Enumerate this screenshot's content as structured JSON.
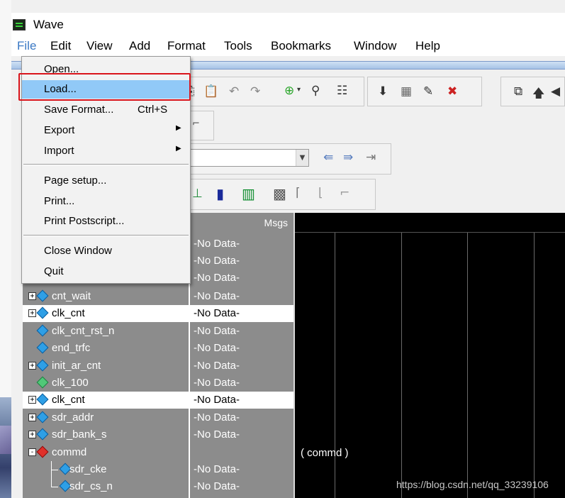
{
  "window": {
    "title": "Wave"
  },
  "menubar": [
    {
      "label": "File",
      "active": true
    },
    {
      "label": "Edit"
    },
    {
      "label": "View"
    },
    {
      "label": "Add"
    },
    {
      "label": "Format"
    },
    {
      "label": "Tools"
    },
    {
      "label": "Bookmarks"
    },
    {
      "label": "Window"
    },
    {
      "label": "Help"
    }
  ],
  "file_menu": {
    "open": "Open...",
    "load": "Load...",
    "save_format": "Save Format...",
    "save_format_shortcut": "Ctrl+S",
    "export": "Export",
    "import": "Import",
    "page_setup": "Page setup...",
    "print": "Print...",
    "print_postscript": "Print Postscript...",
    "close_window": "Close Window",
    "quit": "Quit",
    "highlighted": "Load..."
  },
  "values_header": "Msgs",
  "signals": [
    {
      "name": "",
      "value": "-No Data-"
    },
    {
      "name": "",
      "value": "-No Data-"
    },
    {
      "name": "",
      "value": "-No Data-"
    },
    {
      "name": "cnt_wait",
      "value": "-No Data-",
      "expander": "+",
      "icon": "blue-diamond-icon"
    },
    {
      "name": "clk_cnt",
      "value": "-No Data-",
      "expander": "+",
      "icon": "blue-diamond-icon",
      "selected": true
    },
    {
      "name": "clk_cnt_rst_n",
      "value": "-No Data-",
      "icon": "blue-diamond-icon"
    },
    {
      "name": "end_trfc",
      "value": "-No Data-",
      "icon": "blue-diamond-icon"
    },
    {
      "name": "init_ar_cnt",
      "value": "-No Data-",
      "expander": "+",
      "icon": "blue-diamond-icon"
    },
    {
      "name": "clk_100",
      "value": "-No Data-",
      "icon": "green-diamond-icon"
    },
    {
      "name": "clk_cnt",
      "value": "-No Data-",
      "expander": "+",
      "icon": "blue-diamond-icon",
      "selected": true
    },
    {
      "name": "sdr_addr",
      "value": "-No Data-",
      "expander": "+",
      "icon": "blue-diamond-icon"
    },
    {
      "name": "sdr_bank_s",
      "value": "-No Data-",
      "expander": "+",
      "icon": "blue-diamond-icon"
    },
    {
      "name": "commd",
      "value": "",
      "expander": "-",
      "icon": "red-diamond-icon"
    },
    {
      "name": "sdr_cke",
      "value": "-No Data-",
      "icon": "blue-diamond-icon",
      "child": true
    },
    {
      "name": "sdr_cs_n",
      "value": "-No Data-",
      "icon": "blue-diamond-icon",
      "child": true
    }
  ],
  "wave_labels": {
    "commd": "( commd )"
  },
  "watermark": "https://blog.csdn.net/qq_33239106",
  "colors": {
    "wave_bg": "#000000",
    "pane_bg": "#8c8c8c",
    "highlight": "#91c9f7",
    "callout": "#d9141b"
  }
}
